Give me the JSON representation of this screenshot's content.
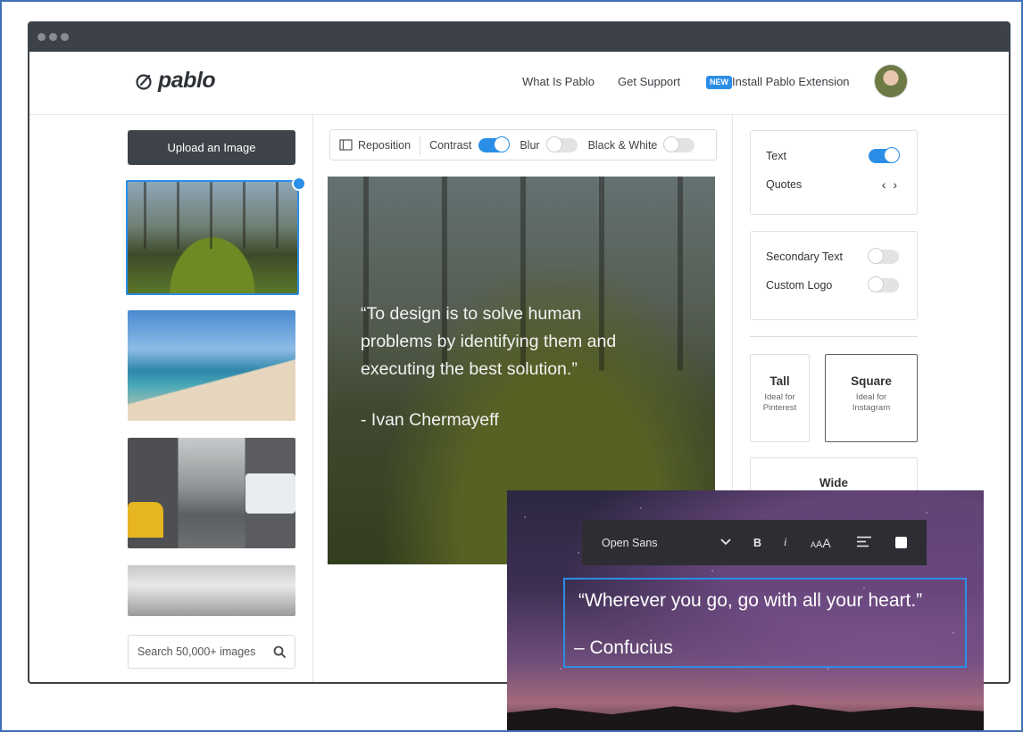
{
  "colors": {
    "accent": "#2a8ee6",
    "titlebar": "#3c4248",
    "frame_border": "#3f6fb5"
  },
  "header": {
    "logo_text": "pablo",
    "nav": {
      "what_is": "What Is Pablo",
      "support": "Get Support",
      "new_badge": "NEW",
      "install": "Install Pablo Extension"
    }
  },
  "sidebar": {
    "upload_label": "Upload an Image",
    "search_placeholder": "Search 50,000+ images"
  },
  "toolbar": {
    "reposition": "Reposition",
    "contrast": {
      "label": "Contrast",
      "on": true
    },
    "blur": {
      "label": "Blur",
      "on": false
    },
    "bw": {
      "label": "Black & White",
      "on": false
    }
  },
  "canvas": {
    "quote_line1": "“To design is to solve human",
    "quote_line2": "problems by identifying them and",
    "quote_line3": "executing the best solution.”",
    "author": "- Ivan Chermayeff"
  },
  "panel": {
    "text": {
      "label": "Text",
      "on": true
    },
    "quotes": {
      "label": "Quotes",
      "icon": "‹ ›"
    },
    "secondary_text": {
      "label": "Secondary Text",
      "on": false
    },
    "custom_logo": {
      "label": "Custom Logo",
      "on": false
    },
    "sizes": {
      "tall": {
        "title": "Tall",
        "sub1": "Ideal for",
        "sub2": "Pinterest"
      },
      "square": {
        "title": "Square",
        "sub1": "Ideal for",
        "sub2": "Instagram"
      },
      "wide": {
        "title": "Wide"
      }
    }
  },
  "overlay": {
    "font": "Open Sans",
    "bold": "B",
    "italic": "i",
    "size_icon": "AAA",
    "quote": "“Wherever you go, go with all your heart.”",
    "author": "– Confucius"
  }
}
